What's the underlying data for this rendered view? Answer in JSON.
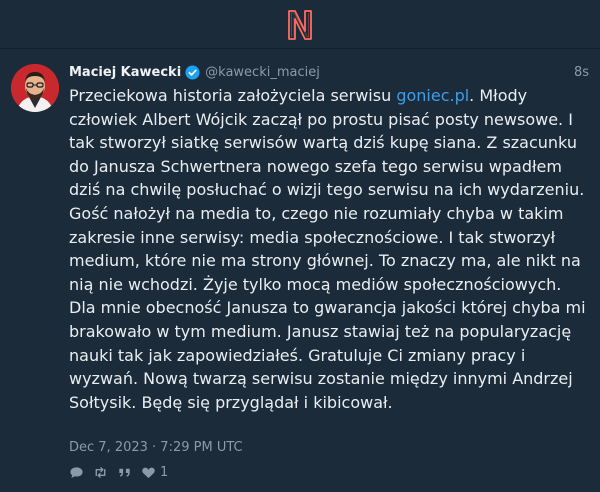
{
  "app": {
    "logo": "N"
  },
  "post": {
    "author": {
      "display_name": "Maciej Kawecki",
      "handle": "@kawecki_maciej",
      "verified": true
    },
    "time_ago": "8s",
    "text_before_link": "Przeciekowa historia założyciela serwisu ",
    "link_text": "goniec.pl",
    "text_after_link": ". Młody człowiek Albert Wójcik zaczął po prostu pisać posty newsowe. I tak stworzył siatkę serwisów wartą dziś kupę siana. Z szacunku do Janusza Schwertnera nowego szefa tego serwisu wpadłem dziś na chwilę posłuchać o wizji tego serwisu na ich wydarzeniu. Gość nałożył na media to, czego nie rozumiały chyba w takim zakresie inne serwisy: media społecznościowe. I tak stworzył medium, które nie ma strony głównej. To znaczy ma, ale nikt na nią nie wchodzi. Żyje tylko mocą mediów społecznościowych. Dla mnie obecność Janusza to gwarancja jakości której chyba mi brakowało w tym medium. Janusz stawiaj też na popularyzację nauki tak jak zapowiedziałeś. Gratuluje Ci zmiany pracy i wyzwań. Nową twarzą serwisu zostanie między innymi Andrzej Sołtysik. Będę się przyglądał i kibicował.",
    "date": "Dec 7, 2023 · 7:29 PM UTC",
    "stats": {
      "likes": "1"
    }
  },
  "icons": {
    "logo": "nitter-logo-icon",
    "verified": "verified-badge-icon",
    "reply": "comment-icon",
    "retweet": "retweet-icon",
    "quote": "quote-icon",
    "like": "heart-icon"
  },
  "colors": {
    "background": "#1c2b39",
    "accent": "#c9282e",
    "link": "#3e9ee5",
    "muted": "#8c9aa8",
    "verified": "#1da1f2"
  }
}
